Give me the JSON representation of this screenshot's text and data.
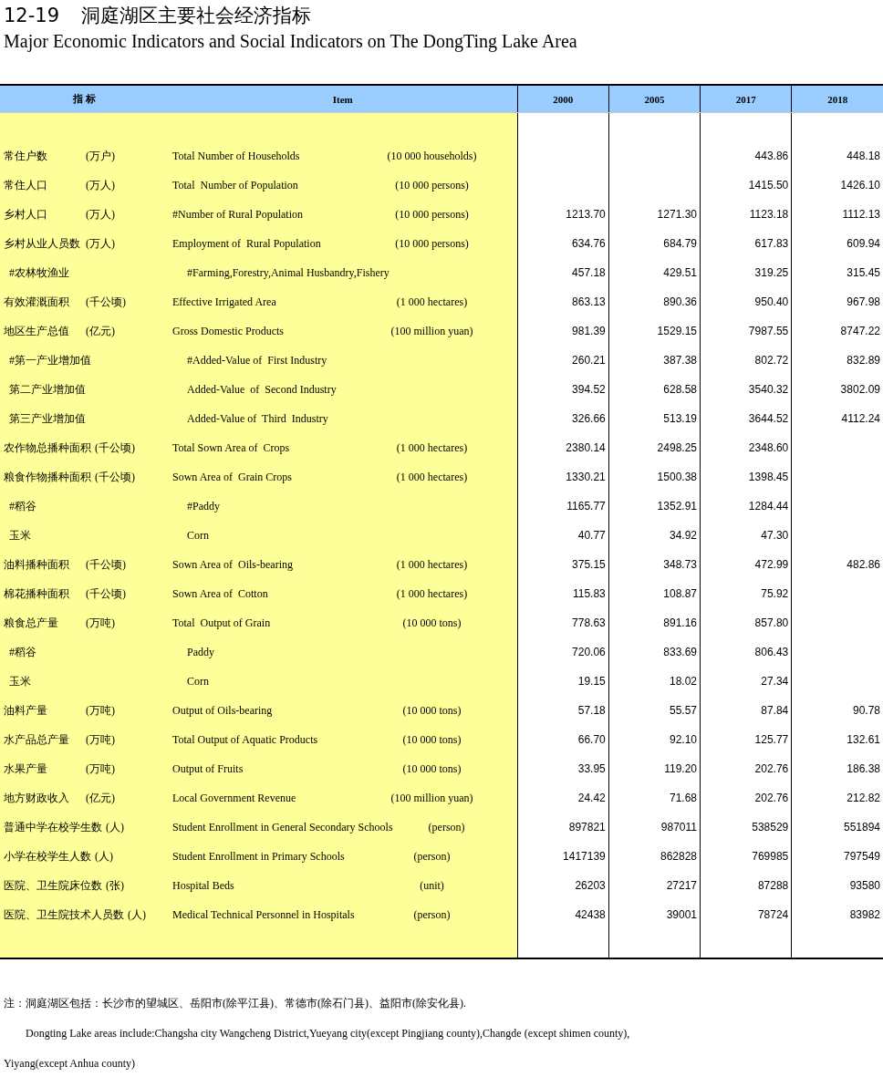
{
  "title": {
    "number": "12-19",
    "chinese": "洞庭湖区主要社会经济指标",
    "english": "Major Economic Indicators and Social Indicators on The DongTing Lake Area"
  },
  "table": {
    "columns": [
      "指 标",
      "Item",
      "2000",
      "2005",
      "2017",
      "2018"
    ],
    "rows": [
      {
        "kind": "main",
        "cn": "常住户数",
        "cn_unit": "(万户)",
        "en": "Total Number of Households",
        "en_unit": "(10 000 households)",
        "values": {
          "v2017": "443.86",
          "v2018": "448.18"
        }
      },
      {
        "kind": "main",
        "cn": "常住人口",
        "cn_unit": "(万人)",
        "en": "Total  Number of Population",
        "en_unit": "(10 000 persons)",
        "values": {
          "v2017": "1415.50",
          "v2018": "1426.10"
        }
      },
      {
        "kind": "main",
        "cn": "乡村人口",
        "cn_unit": "(万人)",
        "en": "#Number of Rural Population",
        "en_unit": "(10 000 persons)",
        "values": [
          "1213.70",
          "1271.30",
          "1123.18",
          "1112.13"
        ]
      },
      {
        "kind": "main",
        "cn": "乡村从业人员数",
        "cn_unit": "(万人)",
        "en": "Employment of  Rural Population",
        "en_unit": "(10 000 persons)",
        "values": [
          "634.76",
          "684.79",
          "617.83",
          "609.94"
        ]
      },
      {
        "kind": "sub",
        "cn": "#农林牧渔业",
        "en": "#Farming,Forestry,Animal Husbandry,Fishery",
        "values": [
          "457.18",
          "429.51",
          "319.25",
          "315.45"
        ]
      },
      {
        "kind": "main",
        "cn": "有效灌溉面积",
        "cn_unit": "(千公顷)",
        "en": "Effective Irrigated Area",
        "en_unit": "(1 000 hectares)",
        "values": [
          "863.13",
          "890.36",
          "950.40",
          "967.98"
        ]
      },
      {
        "kind": "main",
        "cn": "地区生产总值",
        "cn_unit": "(亿元)",
        "en": "Gross Domestic Products",
        "en_unit": "(100 million yuan)",
        "values": [
          "981.39",
          "1529.15",
          "7987.55",
          "8747.22"
        ]
      },
      {
        "kind": "sub",
        "cn": "#第一产业增加值",
        "en": "#Added-Value of  First Industry",
        "values": [
          "260.21",
          "387.38",
          "802.72",
          "832.89"
        ]
      },
      {
        "kind": "sub",
        "cn": "第二产业增加值",
        "en": "Added-Value  of  Second Industry",
        "values": [
          "394.52",
          "628.58",
          "3540.32",
          "3802.09"
        ]
      },
      {
        "kind": "sub",
        "cn": "第三产业增加值",
        "en": "Added-Value of  Third  Industry",
        "values": [
          "326.66",
          "513.19",
          "3644.52",
          "4112.24"
        ]
      },
      {
        "kind": "main",
        "cn": "农作物总播种面积",
        "cn_unit": "(千公顷)",
        "en": "Total Sown Area of  Crops",
        "en_unit": "(1 000 hectares)",
        "values": {
          "v2000": "2380.14",
          "v2005": "2498.25",
          "v2017": "2348.60"
        }
      },
      {
        "kind": "main",
        "cn": "粮食作物播种面积",
        "cn_unit": "(千公顷)",
        "en": "Sown Area of  Grain Crops",
        "en_unit": "(1 000 hectares)",
        "values": {
          "v2000": "1330.21",
          "v2005": "1500.38",
          "v2017": "1398.45"
        }
      },
      {
        "kind": "sub",
        "cn": "#稻谷",
        "en": "#Paddy",
        "values": {
          "v2000": "1165.77",
          "v2005": "1352.91",
          "v2017": "1284.44"
        }
      },
      {
        "kind": "sub",
        "cn": "玉米",
        "en": "Corn",
        "values": {
          "v2000": "40.77",
          "v2005": "34.92",
          "v2017": "47.30"
        }
      },
      {
        "kind": "main",
        "cn": "油料播种面积",
        "cn_unit": "(千公顷)",
        "en": "Sown Area of  Oils-bearing",
        "en_unit": "(1 000 hectares)",
        "values": [
          "375.15",
          "348.73",
          "472.99",
          "482.86"
        ]
      },
      {
        "kind": "main",
        "cn": "棉花播种面积",
        "cn_unit": "(千公顷)",
        "en": "Sown Area of  Cotton",
        "en_unit": "(1 000 hectares)",
        "values": {
          "v2000": "115.83",
          "v2005": "108.87",
          "v2017": "75.92"
        }
      },
      {
        "kind": "main",
        "cn": "粮食总产量",
        "cn_unit": "(万吨)",
        "en": "Total  Output of Grain",
        "en_unit": "(10 000 tons)",
        "values": {
          "v2000": "778.63",
          "v2005": "891.16",
          "v2017": "857.80"
        }
      },
      {
        "kind": "sub",
        "cn": "#稻谷",
        "en": "Paddy",
        "values": {
          "v2000": "720.06",
          "v2005": "833.69",
          "v2017": "806.43"
        }
      },
      {
        "kind": "sub",
        "cn": "玉米",
        "en": "Corn",
        "values": {
          "v2000": "19.15",
          "v2005": "18.02",
          "v2017": "27.34"
        }
      },
      {
        "kind": "main",
        "cn": "油料产量",
        "cn_unit": "(万吨)",
        "en": "Output of Oils-bearing",
        "en_unit": "(10 000 tons)",
        "values": [
          "57.18",
          "55.57",
          "87.84",
          "90.78"
        ]
      },
      {
        "kind": "main",
        "cn": "水产品总产量",
        "cn_unit": "(万吨)",
        "en": "Total Output of Aquatic Products",
        "en_unit": "(10 000 tons)",
        "values": [
          "66.70",
          "92.10",
          "125.77",
          "132.61"
        ]
      },
      {
        "kind": "main",
        "cn": "水果产量",
        "cn_unit": "(万吨)",
        "en": "Output of Fruits",
        "en_unit": "(10 000 tons)",
        "values": [
          "33.95",
          "119.20",
          "202.76",
          "186.38"
        ]
      },
      {
        "kind": "main",
        "cn": "地方财政收入",
        "cn_unit": "(亿元)",
        "en": "Local Government Revenue",
        "en_unit": "(100 million yuan)",
        "values": [
          "24.42",
          "71.68",
          "202.76",
          "212.82"
        ]
      },
      {
        "kind": "main",
        "cn": "普通中学在校学生数",
        "cn_unit": "(人)",
        "en": "Student Enrollment in General Secondary Schools",
        "en_unit": "(person)",
        "values": [
          "897821",
          "987011",
          "538529",
          "551894"
        ]
      },
      {
        "kind": "main",
        "cn": "小学在校学生人数",
        "cn_unit": "(人)",
        "en": "Student Enrollment in Primary Schools",
        "en_unit": "(person)",
        "values": [
          "1417139",
          "862828",
          "769985",
          "797549"
        ]
      },
      {
        "kind": "main",
        "cn": "医院、卫生院床位数",
        "cn_unit": "(张)",
        "en": "Hospital Beds",
        "en_unit": "(unit)",
        "values": [
          "26203",
          "27217",
          "87288",
          "93580"
        ]
      },
      {
        "kind": "main",
        "cn": "医院、卫生院技术人员数",
        "cn_unit": "(人)",
        "en": "Medical Technical Personnel in Hospitals",
        "en_unit": "(person)",
        "values": [
          "42438",
          "39001",
          "78724",
          "83982"
        ]
      }
    ]
  },
  "notes": [
    "注：洞庭湖区包括：长沙市的望城区、岳阳市(除平江县)、常德市(除石门县)、益阳市(除安化县).",
    "Dongting Lake areas include:Changsha city Wangcheng District,Yueyang city(except Pingjiang county),Changde (except shimen county),",
    "Yiyang(except Anhua county)"
  ]
}
